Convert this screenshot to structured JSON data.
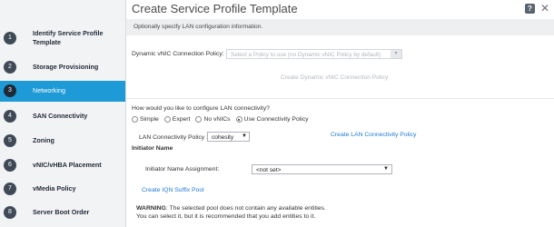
{
  "sidebar": {
    "steps": [
      {
        "num": "1",
        "label_line1": "Identify Service Profile",
        "label_line2": "Template"
      },
      {
        "num": "2",
        "label": "Storage Provisioning"
      },
      {
        "num": "3",
        "label": "Networking"
      },
      {
        "num": "4",
        "label": "SAN Connectivity"
      },
      {
        "num": "5",
        "label": "Zoning"
      },
      {
        "num": "6",
        "label": "vNIC/vHBA Placement"
      },
      {
        "num": "7",
        "label": "vMedia Policy"
      },
      {
        "num": "8",
        "label": "Server Boot Order"
      }
    ],
    "active_step": "Networking"
  },
  "header": {
    "title": "Create Service Profile Template",
    "help": "?",
    "close": "✕"
  },
  "subtitle": "Optionally specify LAN configuration information.",
  "dynamic_vnic": {
    "label": "Dynamic vNIC Connection Policy:",
    "placeholder": "Select a Policy to use (no Dynamic vNIC Policy by default)",
    "create_link": "Create Dynamic vNIC Connection Policy"
  },
  "lan": {
    "question": "How would you like to configure LAN connectivity?",
    "options": [
      "Simple",
      "Expert",
      "No vNICs",
      "Use Connectivity Policy"
    ],
    "selected_option": "Use Connectivity Policy",
    "policy_label": "LAN Connectivity Policy :",
    "policy_value": "cohesity",
    "create_link": "Create LAN Connectivity Policy"
  },
  "initiator": {
    "section_title": "Initiator Name",
    "assignment_label": "Initiator Name Assignment:",
    "assignment_value": "<not set>",
    "create_link": "Create IQN Suffix Pool"
  },
  "warning": {
    "title": "WARNING",
    "line1": ": The selected pool does not contain any available entities.",
    "line2": "You can select it, but it is recommended that you add entities to it."
  },
  "colors": {
    "accent": "#1e9ad6",
    "link": "#1f7ad6",
    "sidebar_bg": "#f2f3f5"
  }
}
